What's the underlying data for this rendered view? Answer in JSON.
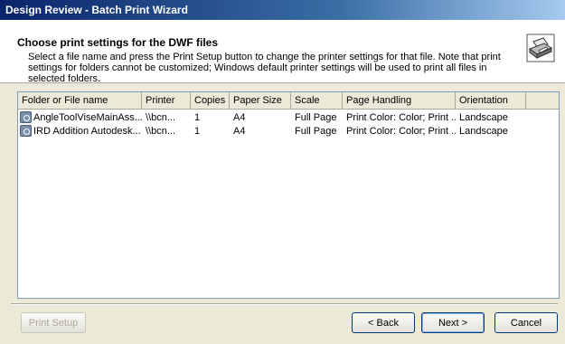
{
  "window": {
    "title": "Design Review - Batch Print Wizard"
  },
  "header": {
    "title": "Choose print settings for the DWF files",
    "description": "Select a file name and press the Print Setup button to change the printer settings for that file. Note that print settings for folders cannot be customized; Windows default printer settings will be used to print all files in selected folders.",
    "icon": "printer-icon"
  },
  "table": {
    "columns": [
      "Folder or File name",
      "Printer",
      "Copies",
      "Paper Size",
      "Scale",
      "Page Handling",
      "Orientation"
    ],
    "rows": [
      {
        "name": "AngleToolViseMainAss...",
        "printer": "\\\\bcn...",
        "copies": "1",
        "paper_size": "A4",
        "scale": "Full Page",
        "page_handling": "Print Color: Color; Print ...",
        "orientation": "Landscape"
      },
      {
        "name": "IRD Addition Autodesk...",
        "printer": "\\\\bcn...",
        "copies": "1",
        "paper_size": "A4",
        "scale": "Full Page",
        "page_handling": "Print Color: Color; Print ...",
        "orientation": "Landscape"
      }
    ]
  },
  "buttons": {
    "print_setup": "Print Setup",
    "back": "< Back",
    "next": "Next >",
    "cancel": "Cancel"
  },
  "colors": {
    "titlebar": "#0a246a",
    "accent": "#3a6ea5",
    "disabled_text": "#aca899"
  }
}
